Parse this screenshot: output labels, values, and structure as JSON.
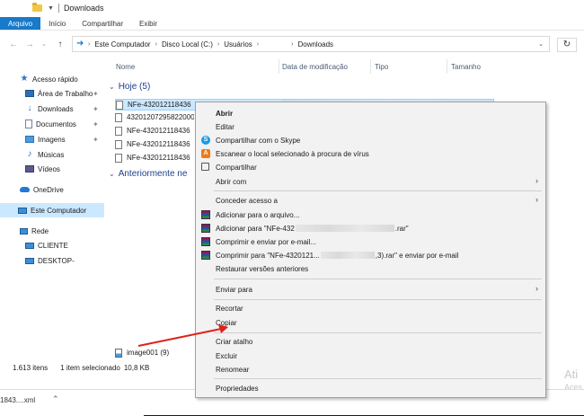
{
  "titlebar": {
    "title": "Downloads"
  },
  "ribbon": {
    "tabs": [
      "Arquivo",
      "Início",
      "Compartilhar",
      "Exibir"
    ]
  },
  "address": {
    "crumbs": [
      "Este Computador",
      "Disco Local (C:)",
      "Usuários",
      "",
      "Downloads"
    ]
  },
  "columns": {
    "name": "Nome",
    "modified": "Data de modificação",
    "type": "Tipo",
    "size": "Tamanho"
  },
  "navpane": {
    "quick_access": "Acesso rápido",
    "items": [
      "Área de Trabalho",
      "Downloads",
      "Documentos",
      "Imagens",
      "Músicas",
      "Vídeos"
    ],
    "onedrive": "OneDrive",
    "this_pc": "Este Computador",
    "network": "Rede",
    "computers": [
      "CLIENTE",
      "DESKTOP-"
    ]
  },
  "files": {
    "group_today": "Hoje (5)",
    "group_earlier": "Anteriormente ne",
    "today": [
      "NFe-432012118436",
      "43201207295822000",
      "NFe-432012118436",
      "NFe-432012118436",
      "NFe-432012118436"
    ],
    "bottom_item": "image001 (9)"
  },
  "status": {
    "count": "1.613 itens",
    "selected": "1 item selecionado",
    "size": "10,8 KB"
  },
  "download_bar": {
    "file": "1843....xml"
  },
  "watermark": {
    "line1": "Ati",
    "line2": "Aces"
  },
  "context_menu": {
    "open": "Abrir",
    "edit": "Editar",
    "skype": "Compartilhar com o Skype",
    "scan": "Escanear o local selecionado à procura de vírus",
    "share": "Compartilhar",
    "open_with": "Abrir com",
    "grant_access": "Conceder acesso a",
    "add_archive": "Adicionar para o arquivo...",
    "add_rar_prefix": "Adicionar para \"NFe-432",
    "add_rar_suffix": ".rar\"",
    "compress_email": "Comprimir e enviar por e-mail...",
    "compress_rar_prefix": "Comprimir para \"NFe-4320121...",
    "compress_rar_suffix": ",3).rar\" e enviar por e-mail",
    "restore": "Restaurar versões anteriores",
    "send_to": "Enviar para",
    "cut": "Recortar",
    "copy": "Copiar",
    "create_shortcut": "Criar atalho",
    "delete": "Excluir",
    "rename": "Renomear",
    "properties": "Propriedades"
  },
  "accent_colors": {
    "file_tab": "#1979ca",
    "selection": "#cce8ff",
    "group_header": "#1e3f8a",
    "arrow": "#e0201b"
  }
}
